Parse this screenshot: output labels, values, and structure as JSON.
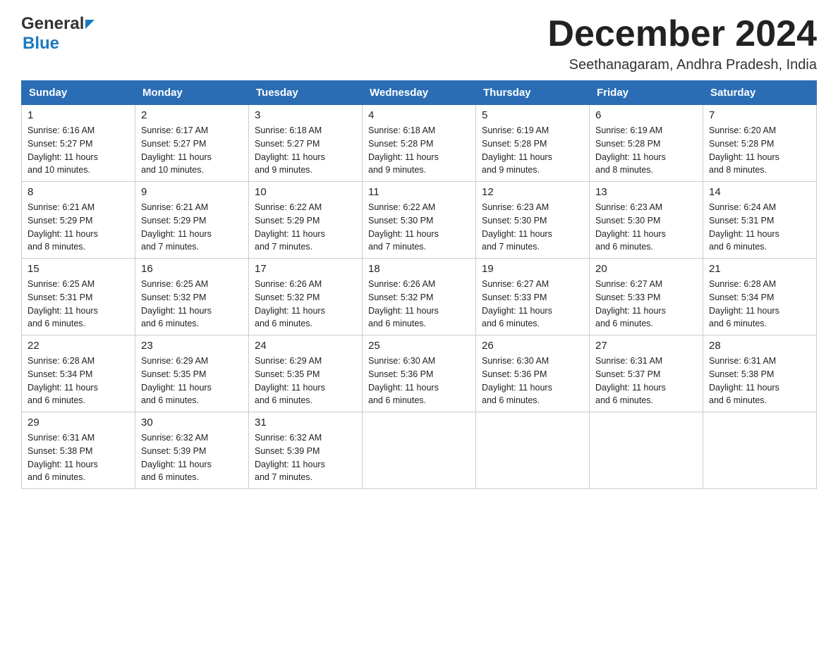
{
  "header": {
    "logo_general": "General",
    "logo_blue": "Blue",
    "month_title": "December 2024",
    "subtitle": "Seethanagaram, Andhra Pradesh, India"
  },
  "days_of_week": [
    "Sunday",
    "Monday",
    "Tuesday",
    "Wednesday",
    "Thursday",
    "Friday",
    "Saturday"
  ],
  "weeks": [
    [
      {
        "day": "1",
        "sunrise": "6:16 AM",
        "sunset": "5:27 PM",
        "daylight": "11 hours and 10 minutes."
      },
      {
        "day": "2",
        "sunrise": "6:17 AM",
        "sunset": "5:27 PM",
        "daylight": "11 hours and 10 minutes."
      },
      {
        "day": "3",
        "sunrise": "6:18 AM",
        "sunset": "5:27 PM",
        "daylight": "11 hours and 9 minutes."
      },
      {
        "day": "4",
        "sunrise": "6:18 AM",
        "sunset": "5:28 PM",
        "daylight": "11 hours and 9 minutes."
      },
      {
        "day": "5",
        "sunrise": "6:19 AM",
        "sunset": "5:28 PM",
        "daylight": "11 hours and 9 minutes."
      },
      {
        "day": "6",
        "sunrise": "6:19 AM",
        "sunset": "5:28 PM",
        "daylight": "11 hours and 8 minutes."
      },
      {
        "day": "7",
        "sunrise": "6:20 AM",
        "sunset": "5:28 PM",
        "daylight": "11 hours and 8 minutes."
      }
    ],
    [
      {
        "day": "8",
        "sunrise": "6:21 AM",
        "sunset": "5:29 PM",
        "daylight": "11 hours and 8 minutes."
      },
      {
        "day": "9",
        "sunrise": "6:21 AM",
        "sunset": "5:29 PM",
        "daylight": "11 hours and 7 minutes."
      },
      {
        "day": "10",
        "sunrise": "6:22 AM",
        "sunset": "5:29 PM",
        "daylight": "11 hours and 7 minutes."
      },
      {
        "day": "11",
        "sunrise": "6:22 AM",
        "sunset": "5:30 PM",
        "daylight": "11 hours and 7 minutes."
      },
      {
        "day": "12",
        "sunrise": "6:23 AM",
        "sunset": "5:30 PM",
        "daylight": "11 hours and 7 minutes."
      },
      {
        "day": "13",
        "sunrise": "6:23 AM",
        "sunset": "5:30 PM",
        "daylight": "11 hours and 6 minutes."
      },
      {
        "day": "14",
        "sunrise": "6:24 AM",
        "sunset": "5:31 PM",
        "daylight": "11 hours and 6 minutes."
      }
    ],
    [
      {
        "day": "15",
        "sunrise": "6:25 AM",
        "sunset": "5:31 PM",
        "daylight": "11 hours and 6 minutes."
      },
      {
        "day": "16",
        "sunrise": "6:25 AM",
        "sunset": "5:32 PM",
        "daylight": "11 hours and 6 minutes."
      },
      {
        "day": "17",
        "sunrise": "6:26 AM",
        "sunset": "5:32 PM",
        "daylight": "11 hours and 6 minutes."
      },
      {
        "day": "18",
        "sunrise": "6:26 AM",
        "sunset": "5:32 PM",
        "daylight": "11 hours and 6 minutes."
      },
      {
        "day": "19",
        "sunrise": "6:27 AM",
        "sunset": "5:33 PM",
        "daylight": "11 hours and 6 minutes."
      },
      {
        "day": "20",
        "sunrise": "6:27 AM",
        "sunset": "5:33 PM",
        "daylight": "11 hours and 6 minutes."
      },
      {
        "day": "21",
        "sunrise": "6:28 AM",
        "sunset": "5:34 PM",
        "daylight": "11 hours and 6 minutes."
      }
    ],
    [
      {
        "day": "22",
        "sunrise": "6:28 AM",
        "sunset": "5:34 PM",
        "daylight": "11 hours and 6 minutes."
      },
      {
        "day": "23",
        "sunrise": "6:29 AM",
        "sunset": "5:35 PM",
        "daylight": "11 hours and 6 minutes."
      },
      {
        "day": "24",
        "sunrise": "6:29 AM",
        "sunset": "5:35 PM",
        "daylight": "11 hours and 6 minutes."
      },
      {
        "day": "25",
        "sunrise": "6:30 AM",
        "sunset": "5:36 PM",
        "daylight": "11 hours and 6 minutes."
      },
      {
        "day": "26",
        "sunrise": "6:30 AM",
        "sunset": "5:36 PM",
        "daylight": "11 hours and 6 minutes."
      },
      {
        "day": "27",
        "sunrise": "6:31 AM",
        "sunset": "5:37 PM",
        "daylight": "11 hours and 6 minutes."
      },
      {
        "day": "28",
        "sunrise": "6:31 AM",
        "sunset": "5:38 PM",
        "daylight": "11 hours and 6 minutes."
      }
    ],
    [
      {
        "day": "29",
        "sunrise": "6:31 AM",
        "sunset": "5:38 PM",
        "daylight": "11 hours and 6 minutes."
      },
      {
        "day": "30",
        "sunrise": "6:32 AM",
        "sunset": "5:39 PM",
        "daylight": "11 hours and 6 minutes."
      },
      {
        "day": "31",
        "sunrise": "6:32 AM",
        "sunset": "5:39 PM",
        "daylight": "11 hours and 7 minutes."
      },
      null,
      null,
      null,
      null
    ]
  ],
  "labels": {
    "sunrise": "Sunrise:",
    "sunset": "Sunset:",
    "daylight": "Daylight:"
  }
}
